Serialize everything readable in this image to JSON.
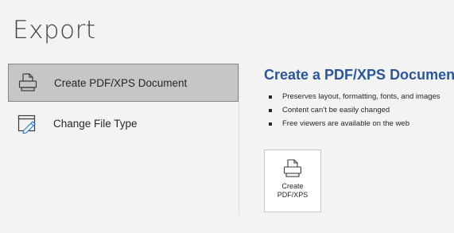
{
  "page": {
    "title": "Export"
  },
  "left_list": {
    "items": [
      {
        "label": "Create PDF/XPS Document",
        "icon": "pdf-document-icon",
        "selected": true
      },
      {
        "label": "Change File Type",
        "icon": "change-file-type-icon",
        "selected": false
      }
    ]
  },
  "detail": {
    "title": "Create a PDF/XPS Document",
    "bullets": [
      "Preserves layout, formatting, fonts, and images",
      "Content can’t be easily changed",
      "Free viewers are available on the web"
    ],
    "button": {
      "label": "Create\nPDF/XPS",
      "icon": "pdf-document-icon"
    }
  },
  "colors": {
    "accent": "#2b579a",
    "selected_bg": "#c8c6c4",
    "panel_bg": "#f3f3f3"
  }
}
